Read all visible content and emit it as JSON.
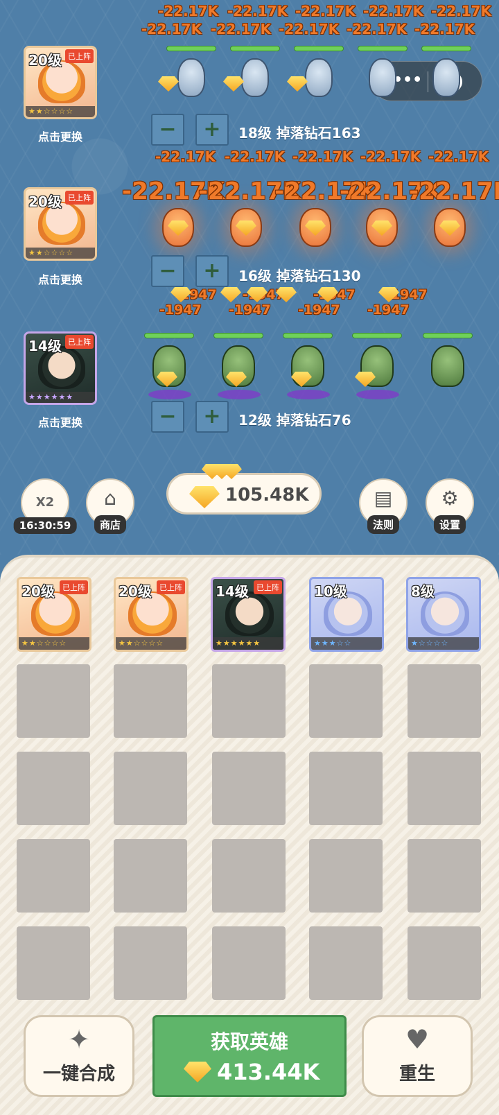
{
  "lanes": [
    {
      "hero": {
        "level": "20级",
        "tag": "已上阵",
        "stars": "★★☆☆☆☆",
        "swap": "点击更换"
      },
      "damage_top": [
        "-22.17K",
        "-22.17K",
        "-22.17K",
        "-22.17K",
        "-22.17K"
      ],
      "damage_bottom": [
        "-22.17K",
        "-22.17K",
        "-22.17K",
        "-22.17K",
        "-22.17K"
      ],
      "minus": "−",
      "plus": "+",
      "info": "18级 掉落钻石163",
      "monster_type": "ice-dragon"
    },
    {
      "hero": {
        "level": "20级",
        "tag": "已上阵",
        "stars": "★★☆☆☆☆",
        "swap": "点击更换"
      },
      "damage_top": [
        "-22.17K",
        "-22.17K",
        "-22.17K",
        "-22.17K",
        "-22.17K"
      ],
      "damage_bottom": [
        "-22.17K",
        "-22.17K",
        "-22.17K",
        "-22.17K",
        "-22.17K"
      ],
      "minus": "−",
      "plus": "+",
      "info": "16级 掉落钻石130",
      "monster_type": "fire-dragon"
    },
    {
      "hero": {
        "level": "14级",
        "tag": "已上阵",
        "stars": "★★★★★★",
        "swap": "点击更换"
      },
      "damage_top": [
        "-1947",
        "-1947",
        "-1947",
        "-1947"
      ],
      "damage_bottom": [
        "-1947",
        "-1947",
        "-1947",
        "-1947"
      ],
      "minus": "−",
      "plus": "+",
      "info": "12级 掉落钻石76",
      "monster_type": "goblin"
    }
  ],
  "menu": {
    "boost_label": "X2",
    "boost_timer": "16:30:59",
    "shop": "商店",
    "rules": "法则",
    "settings": "设置"
  },
  "currency": {
    "gems": "105.48K"
  },
  "inventory": [
    {
      "level": "20级",
      "tag": "已上阵",
      "stars": "★★☆☆☆☆",
      "style": "orange"
    },
    {
      "level": "20级",
      "tag": "已上阵",
      "stars": "★★☆☆☆☆",
      "style": "orange"
    },
    {
      "level": "14级",
      "tag": "已上阵",
      "stars": "★★★★★★",
      "style": "purple"
    },
    {
      "level": "10级",
      "tag": "",
      "stars": "★★★☆☆",
      "style": "blue"
    },
    {
      "level": "8级",
      "tag": "",
      "stars": "★☆☆☆☆",
      "style": "blue"
    }
  ],
  "actions": {
    "merge": "一键合成",
    "get_hero": "获取英雄",
    "get_hero_cost": "413.44K",
    "rebirth": "重生"
  },
  "colors": {
    "field": "#4f7fa8",
    "damage": "#f07a2a",
    "hp": "#6fd15a",
    "get_hero_bg": "#5fb56a"
  }
}
